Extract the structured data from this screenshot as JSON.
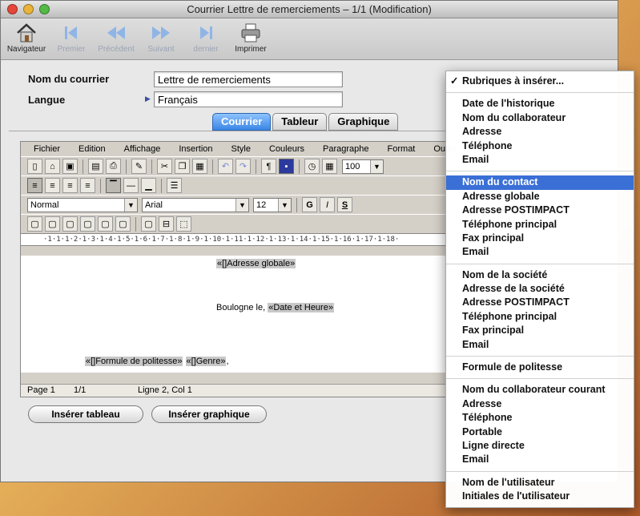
{
  "window": {
    "title": "Courrier Lettre de remerciements – 1/1 (Modification)"
  },
  "toolbar": {
    "items": [
      {
        "label": "Navigateur",
        "icon": "house-icon"
      },
      {
        "label": "Premier",
        "icon": "first-icon"
      },
      {
        "label": "Précédent",
        "icon": "previous-icon"
      },
      {
        "label": "Suivant",
        "icon": "next-icon"
      },
      {
        "label": "dernier",
        "icon": "last-icon"
      },
      {
        "label": "Imprimer",
        "icon": "printer-icon"
      }
    ]
  },
  "form": {
    "nom_label": "Nom du courrier",
    "nom_value": "Lettre de remerciements",
    "langue_label": "Langue",
    "langue_value": "Français"
  },
  "tabs": [
    "Courrier",
    "Tableur",
    "Graphique"
  ],
  "editor": {
    "menus": [
      "Fichier",
      "Edition",
      "Affichage",
      "Insertion",
      "Style",
      "Couleurs",
      "Paragraphe",
      "Format",
      "Outils"
    ],
    "zoom": "100",
    "style": "Normal",
    "font": "Arial",
    "size": "12",
    "bold": "G",
    "italic": "I",
    "underline": "S",
    "ruler_text": "·1·1·1·2·1·3·1·4·1·5·1·6·1·7·1·8·1·9·1·10·1·11·1·12·1·13·1·14·1·15·1·16·1·17·1·18·",
    "doc": {
      "adresse_field": "«[]Adresse globale»",
      "city_text": "Boulogne le,",
      "date_field": "«Date et Heure»",
      "formule_field": "«[]Formule de politesse»",
      "genre_field": "«[]Genre»",
      "comma": ","
    },
    "status": {
      "page": "Page 1",
      "pages": "1/1",
      "position": "Ligne 2, Col 1"
    }
  },
  "buttons": {
    "insert_table": "Insérer tableau",
    "insert_chart": "Insérer graphique"
  },
  "menu": {
    "header": "Rubriques à insérer...",
    "checkmark": "✓",
    "group1": [
      "Date de l'historique",
      "Nom du collaborateur",
      "Adresse",
      "Téléphone",
      "Email"
    ],
    "group2": [
      "Nom du contact",
      "Adresse globale",
      "Adresse POSTIMPACT",
      "Téléphone principal",
      "Fax principal",
      "Email"
    ],
    "group3": [
      "Nom de la société",
      "Adresse de la société",
      "Adresse POSTIMPACT",
      "Téléphone principal",
      "Fax principal",
      "Email"
    ],
    "group4": [
      "Formule de politesse"
    ],
    "group5": [
      "Nom du collaborateur courant",
      "Adresse",
      "Téléphone",
      "Portable",
      "Ligne directe",
      "Email"
    ],
    "group6": [
      "Nom de l'utilisateur",
      "Initiales de l'utilisateur"
    ]
  },
  "colors": {
    "accent": "#3a6fd6",
    "tab_active": "#3a86e6"
  }
}
